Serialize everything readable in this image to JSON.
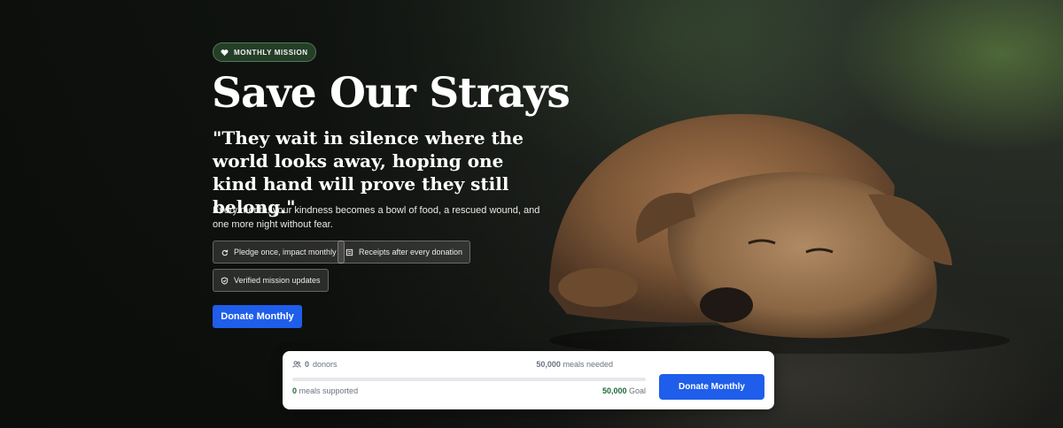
{
  "hero": {
    "badge": "MONTHLY MISSION",
    "badge_icon": "heart-icon",
    "title": "Save Our Strays",
    "quote": "\"They wait in silence where the world looks away, hoping one kind hand will prove they still belong.\"",
    "description": "Every month, your kindness becomes a bowl of food, a rescued wound, and one more night without fear.",
    "chips": [
      {
        "icon": "refresh-icon",
        "label": "Pledge once, impact monthly"
      },
      {
        "icon": "receipt-icon",
        "label": "Receipts after every donation"
      },
      {
        "icon": "shield-check-icon",
        "label": "Verified mission updates"
      }
    ],
    "cta_label": "Donate Monthly"
  },
  "progress_card": {
    "donors_count": "0",
    "donors_label": "donors",
    "needed_value": "50,000",
    "needed_label": "meals needed",
    "progress_fraction": 0,
    "supported_value": "0",
    "supported_label": "meals supported",
    "goal_value": "50,000",
    "goal_label": "Goal",
    "cta_label": "Donate Monthly"
  },
  "colors": {
    "primary_button": "#1f5eea",
    "badge_green": "#284630",
    "progress_green": "#1f7a3a"
  }
}
